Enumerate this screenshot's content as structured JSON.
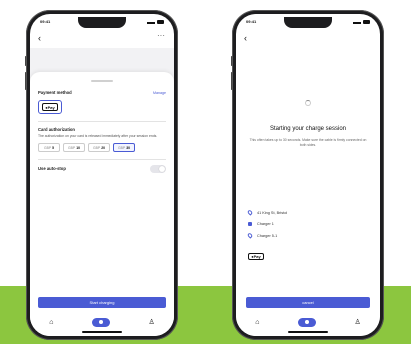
{
  "colors": {
    "accent": "#4a5bd4",
    "band": "#8cc63f",
    "frame": "#1d1d1f"
  },
  "status": {
    "time": "09:41"
  },
  "left": {
    "payment_method_label": "Payment method",
    "manage_link": "Manage",
    "pay_badge": "Pay",
    "card_auth_label": "Card authorization",
    "card_auth_desc": "The authorization on your card is released immediately after your session ends.",
    "currency": "GBP",
    "amounts": [
      "5",
      "10",
      "20",
      "30"
    ],
    "selected_amount_index": 3,
    "auto_stop_label": "Use auto-stop",
    "auto_stop_on": false,
    "start_button": "Start charging"
  },
  "right": {
    "headline": "Starting your charge session",
    "subline": "This often takes up to 30 seconds. Make sure the cable is firmly connected on both sides.",
    "address": "41 King St, Bristol",
    "charger": "Charger 1",
    "connector": "Charger 5-1",
    "pay_badge": "Pay",
    "cancel_button": "cancel"
  },
  "icons": {
    "back": "chevron-left-icon",
    "more": "more-dots-icon",
    "home": "home-icon",
    "charge": "charge-icon",
    "profile": "person-icon"
  }
}
